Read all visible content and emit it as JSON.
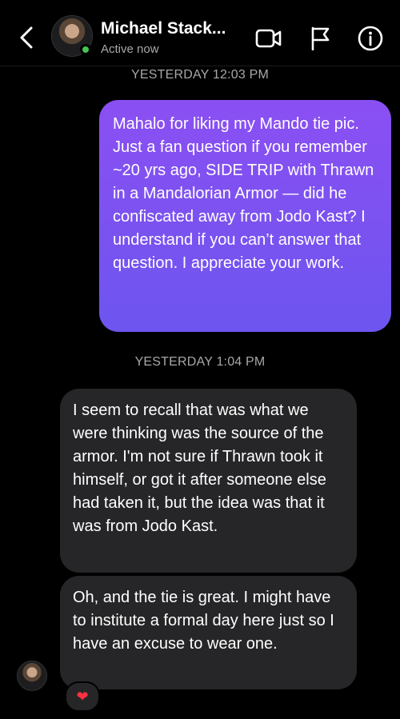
{
  "header": {
    "contact_name": "Michael Stack...",
    "status": "Active now",
    "icons": [
      "back-chevron-icon",
      "video-camera-icon",
      "flag-icon",
      "info-icon"
    ]
  },
  "messages": {
    "timestamp_1": "YESTERDAY 12:03 PM",
    "outgoing_1": "Mahalo for liking my Mando tie pic. Just a fan question if you remember ~20 yrs ago, SIDE TRIP with Thrawn in a Mandalorian Armor — did he confiscated away from Jodo Kast? I understand if you can’t answer that question. I appreciate your work.",
    "timestamp_2": "YESTERDAY 1:04 PM",
    "incoming_1": "I seem to recall that was what we were thinking was the source of the armor. I'm not sure if Thrawn took it himself, or got it after someone else had taken it, but the idea was that it was from Jodo Kast.",
    "incoming_2": "Oh, and the tie is great. I might have to institute a formal day here just so I have an excuse to wear one.",
    "reaction": "❤"
  },
  "colors": {
    "outgoing_gradient_top": "#8b4ff2",
    "outgoing_gradient_bottom": "#6d55ef",
    "incoming_bubble": "#262628",
    "online": "#44c553"
  }
}
